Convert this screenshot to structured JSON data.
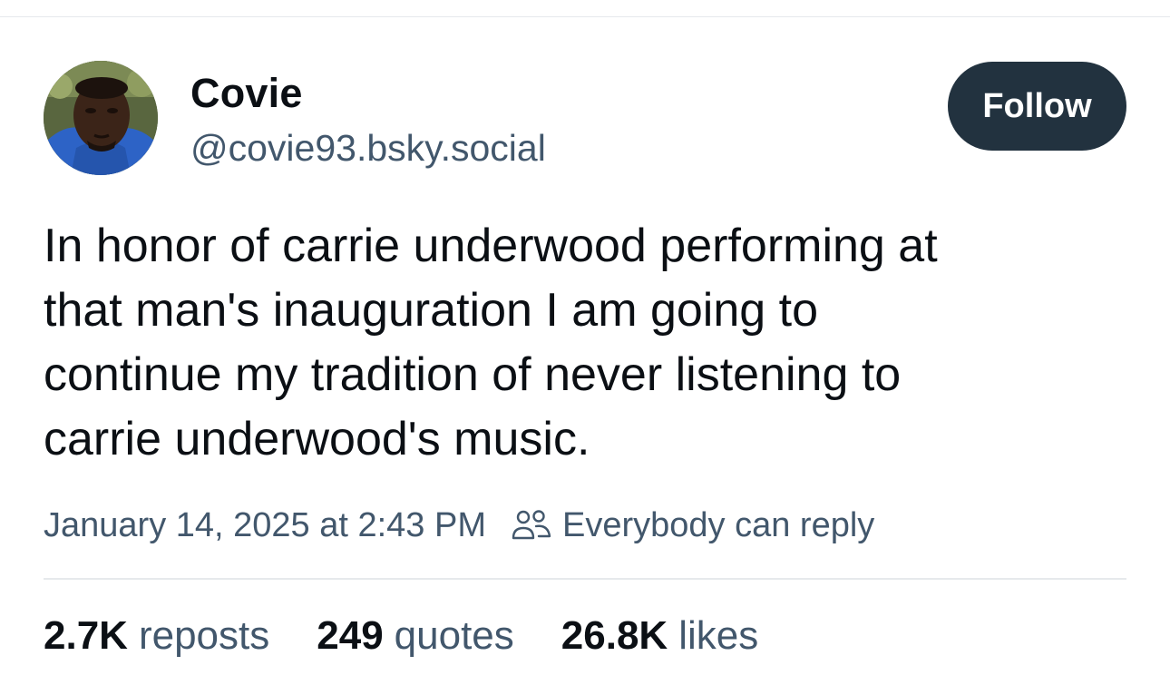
{
  "post": {
    "author": {
      "display_name": "Covie",
      "handle": "@covie93.bsky.social",
      "avatar_icon": "avatar-photo"
    },
    "follow_label": "Follow",
    "text": "In honor of carrie underwood performing at\nthat man's inauguration I am going to\ncontinue my tradition of never listening to\ncarrie underwood's music.",
    "timestamp": "January 14, 2025 at 2:43 PM",
    "reply_setting": {
      "icon": "people-icon",
      "label": "Everybody can reply"
    },
    "stats": {
      "reposts": {
        "count": "2.7K",
        "label": "reposts"
      },
      "quotes": {
        "count": "249",
        "label": "quotes"
      },
      "likes": {
        "count": "26.8K",
        "label": "likes"
      }
    }
  },
  "colors": {
    "text_primary": "#0b0f14",
    "text_secondary": "#42576c",
    "button_bg": "#22323f",
    "divider": "#e6e9ec"
  }
}
